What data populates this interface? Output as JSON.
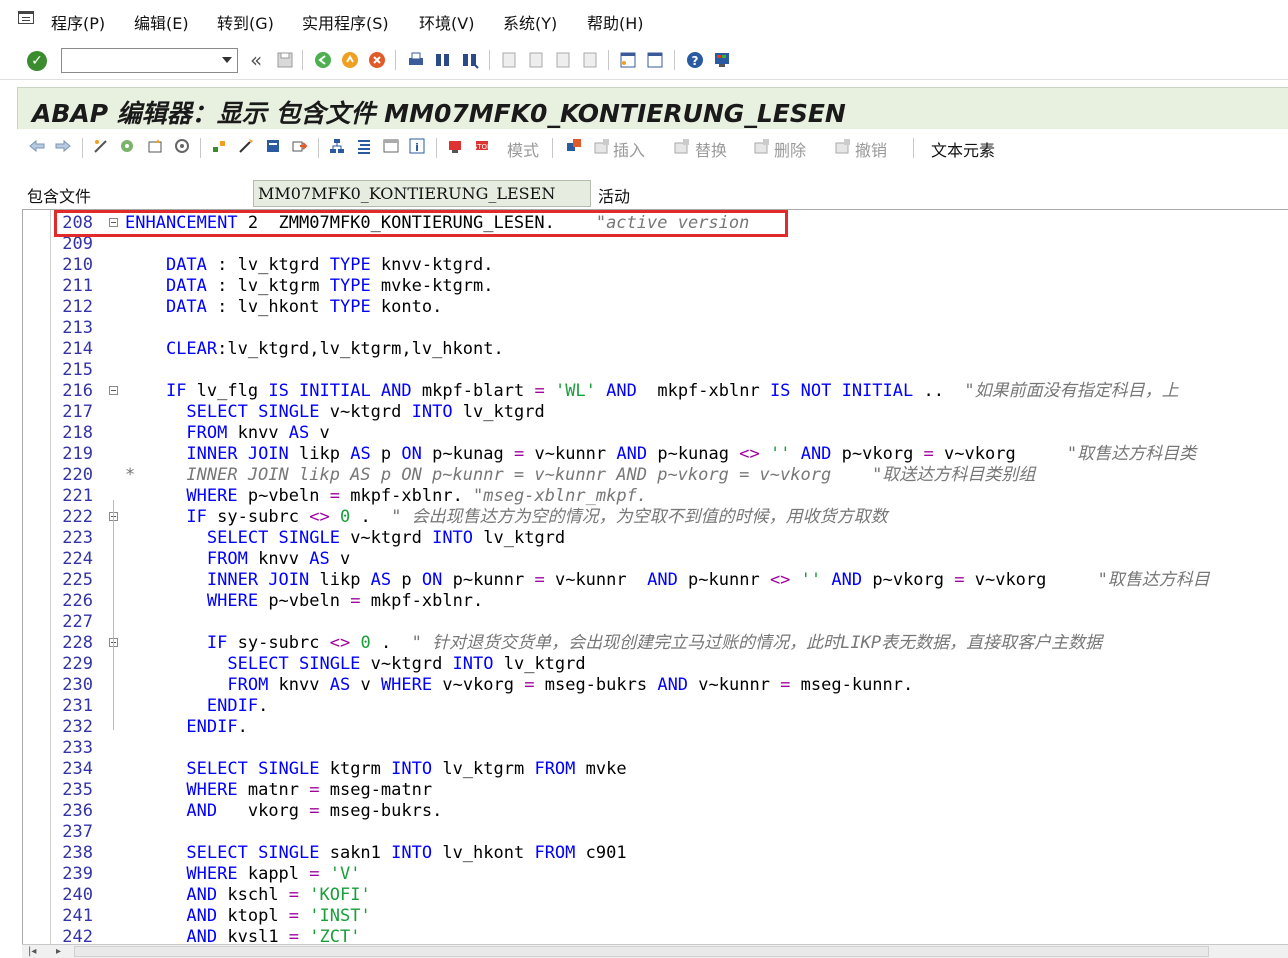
{
  "menubar": {
    "items": [
      "程序(P)",
      "编辑(E)",
      "转到(G)",
      "实用程序(S)",
      "环境(V)",
      "系统(Y)",
      "帮助(H)"
    ]
  },
  "toolbar": {
    "ok_icon": "check-icon",
    "command_field_value": "",
    "icons": [
      "collapse-icon",
      "save-icon",
      "back-icon",
      "exit-icon",
      "cancel-icon",
      "print-icon",
      "find-icon",
      "find-next-icon",
      "first-page-icon",
      "prev-page-icon",
      "next-page-icon",
      "last-page-icon",
      "new-session-icon",
      "shortcut-icon",
      "help-icon",
      "customize-layout-icon"
    ]
  },
  "title": "ABAP 编辑器：显示 包含文件 MM07MFK0_KONTIERUNG_LESEN",
  "app_toolbar": {
    "mode_label": "模式",
    "insert_label": "插入",
    "replace_label": "替换",
    "delete_label": "删除",
    "undo_label": "撤销",
    "text_elements_label": "文本元素"
  },
  "include": {
    "label": "包含文件",
    "value": "MM07MFK0_KONTIERUNG_LESEN",
    "status": "活动"
  },
  "colors": {
    "highlight_box": "#e12b2b",
    "keyword": "#0000ff",
    "string": "#1a9e3a",
    "comment": "#777777",
    "title_bar_bg": "#e8f0e0"
  },
  "code_lines": [
    {
      "ln": "208",
      "fold": true,
      "code": [
        {
          "t": "ENHANCEMENT",
          "c": "kw"
        },
        {
          "t": " 2  ZMM07MFK0_KONTIERUNG_LESEN.    "
        },
        {
          "t": "\"active version",
          "c": "cmt"
        }
      ]
    },
    {
      "ln": "209",
      "code": []
    },
    {
      "ln": "210",
      "code": [
        {
          "t": "    "
        },
        {
          "t": "DATA",
          "c": "kw"
        },
        {
          "t": " : lv_ktgrd "
        },
        {
          "t": "TYPE",
          "c": "kw"
        },
        {
          "t": " knvv-ktgrd."
        }
      ]
    },
    {
      "ln": "211",
      "code": [
        {
          "t": "    "
        },
        {
          "t": "DATA",
          "c": "kw"
        },
        {
          "t": " : lv_ktgrm "
        },
        {
          "t": "TYPE",
          "c": "kw"
        },
        {
          "t": " mvke-ktgrm."
        }
      ]
    },
    {
      "ln": "212",
      "code": [
        {
          "t": "    "
        },
        {
          "t": "DATA",
          "c": "kw"
        },
        {
          "t": " : lv_hkont "
        },
        {
          "t": "TYPE",
          "c": "kw"
        },
        {
          "t": " konto."
        }
      ]
    },
    {
      "ln": "213",
      "code": []
    },
    {
      "ln": "214",
      "code": [
        {
          "t": "    "
        },
        {
          "t": "CLEAR",
          "c": "kw"
        },
        {
          "t": ":lv_ktgrd,lv_ktgrm,lv_hkont."
        }
      ]
    },
    {
      "ln": "215",
      "code": []
    },
    {
      "ln": "216",
      "fold": true,
      "code": [
        {
          "t": "    "
        },
        {
          "t": "IF",
          "c": "kw"
        },
        {
          "t": " lv_flg "
        },
        {
          "t": "IS INITIAL AND",
          "c": "kw"
        },
        {
          "t": " mkpf-blart "
        },
        {
          "t": "=",
          "c": "op"
        },
        {
          "t": " "
        },
        {
          "t": "'WL'",
          "c": "str"
        },
        {
          "t": " "
        },
        {
          "t": "AND",
          "c": "kw"
        },
        {
          "t": "  mkpf-xblnr "
        },
        {
          "t": "IS NOT INITIAL",
          "c": "kw"
        },
        {
          "t": " ..  "
        },
        {
          "t": "\"如果前面没有指定科目，上",
          "c": "cmt"
        }
      ]
    },
    {
      "ln": "217",
      "code": [
        {
          "t": "      "
        },
        {
          "t": "SELECT SINGLE",
          "c": "kw"
        },
        {
          "t": " v~ktgrd "
        },
        {
          "t": "INTO",
          "c": "kw"
        },
        {
          "t": " lv_ktgrd"
        }
      ]
    },
    {
      "ln": "218",
      "code": [
        {
          "t": "      "
        },
        {
          "t": "FROM",
          "c": "kw"
        },
        {
          "t": " knvv "
        },
        {
          "t": "AS",
          "c": "kw"
        },
        {
          "t": " v"
        }
      ]
    },
    {
      "ln": "219",
      "code": [
        {
          "t": "      "
        },
        {
          "t": "INNER JOIN",
          "c": "kw"
        },
        {
          "t": " likp "
        },
        {
          "t": "AS",
          "c": "kw"
        },
        {
          "t": " p "
        },
        {
          "t": "ON",
          "c": "kw"
        },
        {
          "t": " p~kunag "
        },
        {
          "t": "=",
          "c": "op"
        },
        {
          "t": " v~kunnr "
        },
        {
          "t": "AND",
          "c": "kw"
        },
        {
          "t": " p~kunag "
        },
        {
          "t": "<>",
          "c": "op"
        },
        {
          "t": " "
        },
        {
          "t": "''",
          "c": "str"
        },
        {
          "t": " "
        },
        {
          "t": "AND",
          "c": "kw"
        },
        {
          "t": " p~vkorg "
        },
        {
          "t": "=",
          "c": "op"
        },
        {
          "t": " v~vkorg     "
        },
        {
          "t": "\"取售达方科目类",
          "c": "cmt"
        }
      ]
    },
    {
      "ln": "220",
      "star": true,
      "code": [
        {
          "t": "      INNER JOIN likp AS p ON p~kunnr = v~kunnr AND p~vkorg = v~vkorg    \"取送达方科目类别组",
          "c": "cmt"
        }
      ]
    },
    {
      "ln": "221",
      "code": [
        {
          "t": "      "
        },
        {
          "t": "WHERE",
          "c": "kw"
        },
        {
          "t": " p~vbeln "
        },
        {
          "t": "=",
          "c": "op"
        },
        {
          "t": " mkpf-xblnr. "
        },
        {
          "t": "\"mseg-xblnr_mkpf.",
          "c": "cmt"
        }
      ]
    },
    {
      "ln": "222",
      "fold": true,
      "code": [
        {
          "t": "      "
        },
        {
          "t": "IF",
          "c": "kw"
        },
        {
          "t": " sy-subrc "
        },
        {
          "t": "<>",
          "c": "op"
        },
        {
          "t": " "
        },
        {
          "t": "0",
          "c": "num"
        },
        {
          "t": " .  "
        },
        {
          "t": "\" 会出现售达方为空的情况，为空取不到值的时候，用收货方取数",
          "c": "cmt"
        }
      ]
    },
    {
      "ln": "223",
      "code": [
        {
          "t": "        "
        },
        {
          "t": "SELECT SINGLE",
          "c": "kw"
        },
        {
          "t": " v~ktgrd "
        },
        {
          "t": "INTO",
          "c": "kw"
        },
        {
          "t": " lv_ktgrd"
        }
      ]
    },
    {
      "ln": "224",
      "code": [
        {
          "t": "        "
        },
        {
          "t": "FROM",
          "c": "kw"
        },
        {
          "t": " knvv "
        },
        {
          "t": "AS",
          "c": "kw"
        },
        {
          "t": " v"
        }
      ]
    },
    {
      "ln": "225",
      "code": [
        {
          "t": "        "
        },
        {
          "t": "INNER JOIN",
          "c": "kw"
        },
        {
          "t": " likp "
        },
        {
          "t": "AS",
          "c": "kw"
        },
        {
          "t": " p "
        },
        {
          "t": "ON",
          "c": "kw"
        },
        {
          "t": " p~kunnr "
        },
        {
          "t": "=",
          "c": "op"
        },
        {
          "t": " v~kunnr  "
        },
        {
          "t": "AND",
          "c": "kw"
        },
        {
          "t": " p~kunnr "
        },
        {
          "t": "<>",
          "c": "op"
        },
        {
          "t": " "
        },
        {
          "t": "''",
          "c": "str"
        },
        {
          "t": " "
        },
        {
          "t": "AND",
          "c": "kw"
        },
        {
          "t": " p~vkorg "
        },
        {
          "t": "=",
          "c": "op"
        },
        {
          "t": " v~vkorg     "
        },
        {
          "t": "\"取售达方科目",
          "c": "cmt"
        }
      ]
    },
    {
      "ln": "226",
      "code": [
        {
          "t": "        "
        },
        {
          "t": "WHERE",
          "c": "kw"
        },
        {
          "t": " p~vbeln "
        },
        {
          "t": "=",
          "c": "op"
        },
        {
          "t": " mkpf-xblnr."
        }
      ]
    },
    {
      "ln": "227",
      "code": []
    },
    {
      "ln": "228",
      "fold": true,
      "code": [
        {
          "t": "        "
        },
        {
          "t": "IF",
          "c": "kw"
        },
        {
          "t": " sy-subrc "
        },
        {
          "t": "<>",
          "c": "op"
        },
        {
          "t": " "
        },
        {
          "t": "0",
          "c": "num"
        },
        {
          "t": " .  "
        },
        {
          "t": "\" 针对退货交货单，会出现创建完立马过账的情况，此时LIKP表无数据，直接取客户主数据",
          "c": "cmt"
        }
      ]
    },
    {
      "ln": "229",
      "code": [
        {
          "t": "          "
        },
        {
          "t": "SELECT SINGLE",
          "c": "kw"
        },
        {
          "t": " v~ktgrd "
        },
        {
          "t": "INTO",
          "c": "kw"
        },
        {
          "t": " lv_ktgrd"
        }
      ]
    },
    {
      "ln": "230",
      "code": [
        {
          "t": "          "
        },
        {
          "t": "FROM",
          "c": "kw"
        },
        {
          "t": " knvv "
        },
        {
          "t": "AS",
          "c": "kw"
        },
        {
          "t": " v "
        },
        {
          "t": "WHERE",
          "c": "kw"
        },
        {
          "t": " v~vkorg "
        },
        {
          "t": "=",
          "c": "op"
        },
        {
          "t": " mseg-bukrs "
        },
        {
          "t": "AND",
          "c": "kw"
        },
        {
          "t": " v~kunnr "
        },
        {
          "t": "=",
          "c": "op"
        },
        {
          "t": " mseg-kunnr."
        }
      ]
    },
    {
      "ln": "231",
      "code": [
        {
          "t": "        "
        },
        {
          "t": "ENDIF",
          "c": "kw"
        },
        {
          "t": "."
        }
      ]
    },
    {
      "ln": "232",
      "code": [
        {
          "t": "      "
        },
        {
          "t": "ENDIF",
          "c": "kw"
        },
        {
          "t": "."
        }
      ]
    },
    {
      "ln": "233",
      "code": []
    },
    {
      "ln": "234",
      "code": [
        {
          "t": "      "
        },
        {
          "t": "SELECT SINGLE",
          "c": "kw"
        },
        {
          "t": " ktgrm "
        },
        {
          "t": "INTO",
          "c": "kw"
        },
        {
          "t": " lv_ktgrm "
        },
        {
          "t": "FROM",
          "c": "kw"
        },
        {
          "t": " mvke"
        }
      ]
    },
    {
      "ln": "235",
      "code": [
        {
          "t": "      "
        },
        {
          "t": "WHERE",
          "c": "kw"
        },
        {
          "t": " matnr "
        },
        {
          "t": "=",
          "c": "op"
        },
        {
          "t": " mseg-matnr"
        }
      ]
    },
    {
      "ln": "236",
      "code": [
        {
          "t": "      "
        },
        {
          "t": "AND",
          "c": "kw"
        },
        {
          "t": "   vkorg "
        },
        {
          "t": "=",
          "c": "op"
        },
        {
          "t": " mseg-bukrs."
        }
      ]
    },
    {
      "ln": "237",
      "code": []
    },
    {
      "ln": "238",
      "code": [
        {
          "t": "      "
        },
        {
          "t": "SELECT SINGLE",
          "c": "kw"
        },
        {
          "t": " sakn1 "
        },
        {
          "t": "INTO",
          "c": "kw"
        },
        {
          "t": " lv_hkont "
        },
        {
          "t": "FROM",
          "c": "kw"
        },
        {
          "t": " c901"
        }
      ]
    },
    {
      "ln": "239",
      "code": [
        {
          "t": "      "
        },
        {
          "t": "WHERE",
          "c": "kw"
        },
        {
          "t": " kappl "
        },
        {
          "t": "=",
          "c": "op"
        },
        {
          "t": " "
        },
        {
          "t": "'V'",
          "c": "str"
        }
      ]
    },
    {
      "ln": "240",
      "code": [
        {
          "t": "      "
        },
        {
          "t": "AND",
          "c": "kw"
        },
        {
          "t": " kschl "
        },
        {
          "t": "=",
          "c": "op"
        },
        {
          "t": " "
        },
        {
          "t": "'KOFI'",
          "c": "str"
        }
      ]
    },
    {
      "ln": "241",
      "code": [
        {
          "t": "      "
        },
        {
          "t": "AND",
          "c": "kw"
        },
        {
          "t": " ktopl "
        },
        {
          "t": "=",
          "c": "op"
        },
        {
          "t": " "
        },
        {
          "t": "'INST'",
          "c": "str"
        }
      ]
    },
    {
      "ln": "242",
      "code": [
        {
          "t": "      "
        },
        {
          "t": "AND",
          "c": "kw"
        },
        {
          "t": " kvsl1 "
        },
        {
          "t": "=",
          "c": "op"
        },
        {
          "t": " "
        },
        {
          "t": "'ZCT'",
          "c": "str"
        }
      ]
    }
  ]
}
